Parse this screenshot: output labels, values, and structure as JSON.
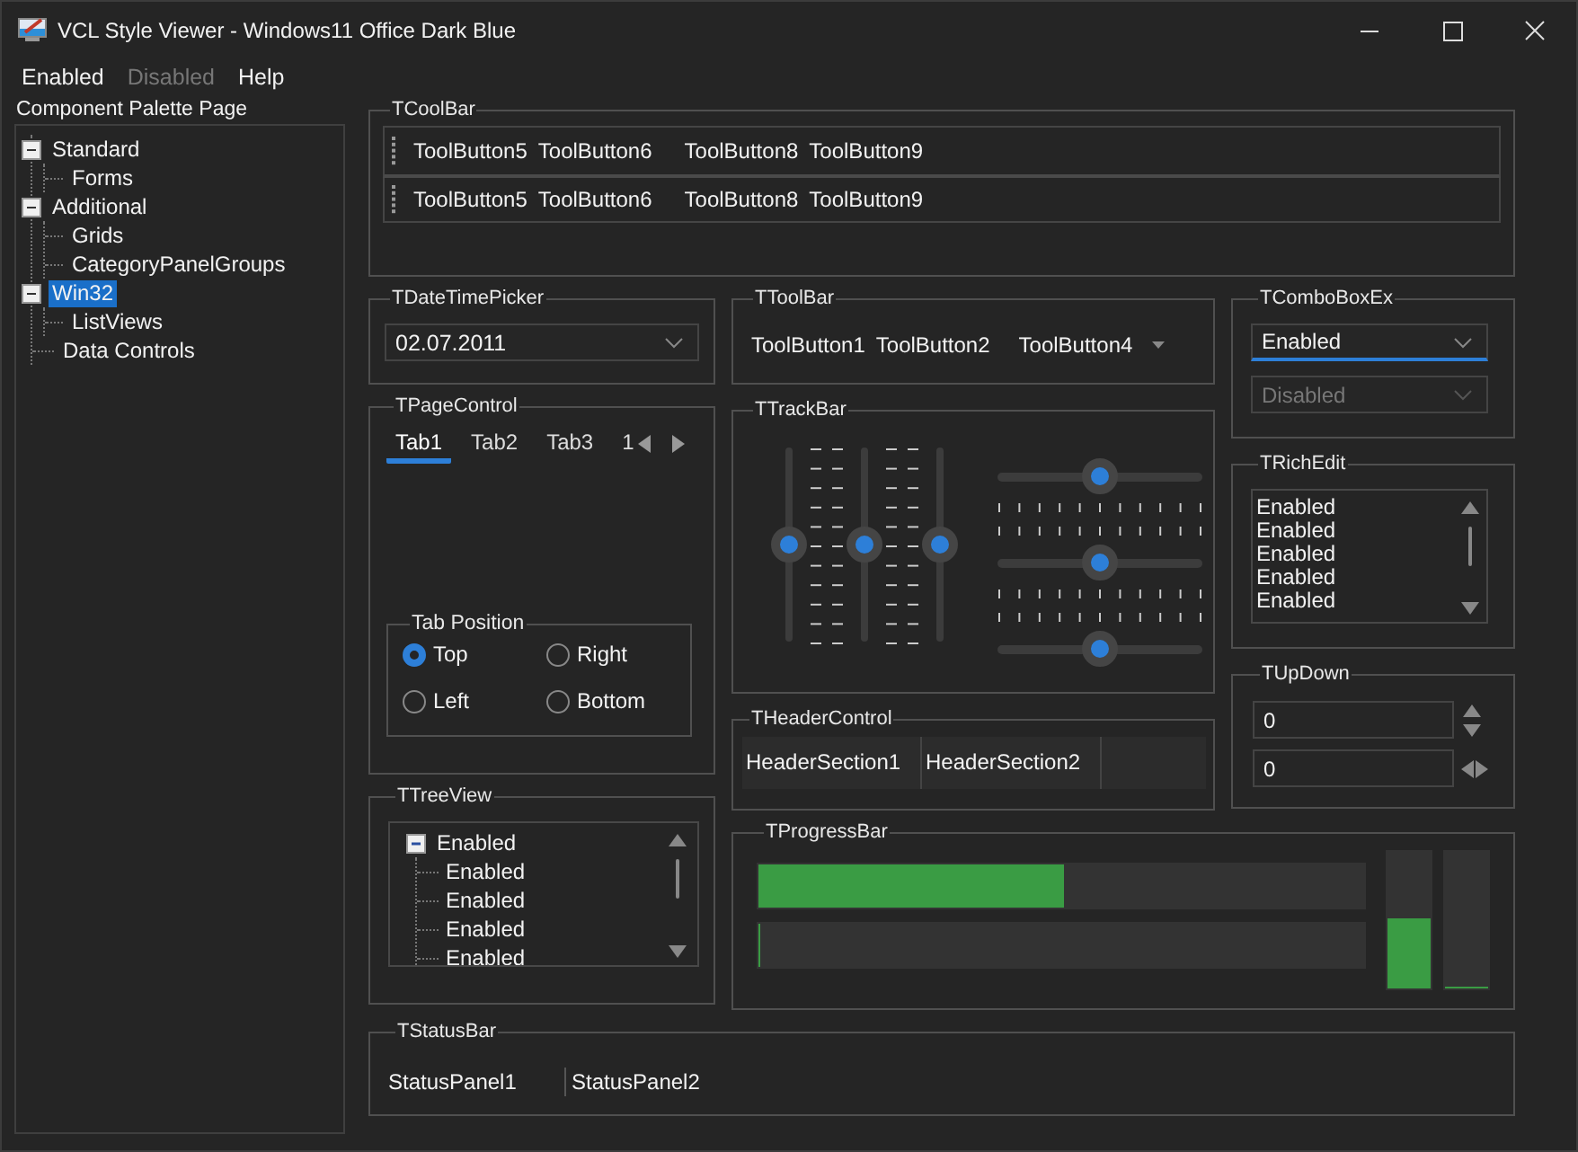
{
  "window": {
    "title": "VCL Style Viewer - Windows11 Office Dark Blue"
  },
  "menu": [
    {
      "label": "Enabled",
      "disabled": false
    },
    {
      "label": "Disabled",
      "disabled": true
    },
    {
      "label": "Help",
      "disabled": false
    }
  ],
  "palette": {
    "label": "Component Palette Page",
    "items": [
      {
        "label": "Standard",
        "expanded": true,
        "selected": false,
        "children": [
          {
            "label": "Forms",
            "selected": false
          }
        ]
      },
      {
        "label": "Additional",
        "expanded": true,
        "selected": false,
        "children": [
          {
            "label": "Grids",
            "selected": false
          },
          {
            "label": "CategoryPanelGroups",
            "selected": false
          }
        ]
      },
      {
        "label": "Win32",
        "expanded": true,
        "selected": true,
        "children": [
          {
            "label": "ListViews",
            "selected": false
          }
        ]
      },
      {
        "label": "Data Controls",
        "selected": false
      }
    ]
  },
  "coolbar": {
    "title": "TCoolBar",
    "bands": [
      {
        "items": [
          {
            "kind": "button",
            "label": "ToolButton5"
          },
          {
            "kind": "button",
            "label": "ToolButton6"
          },
          {
            "kind": "separator"
          },
          {
            "kind": "button",
            "label": "ToolButton8"
          },
          {
            "kind": "button",
            "label": "ToolButton9"
          }
        ]
      },
      {
        "items": [
          {
            "kind": "button",
            "label": "ToolButton5"
          },
          {
            "kind": "button",
            "label": "ToolButton6"
          },
          {
            "kind": "separator"
          },
          {
            "kind": "button",
            "label": "ToolButton8"
          },
          {
            "kind": "button",
            "label": "ToolButton9"
          }
        ]
      }
    ]
  },
  "datetimepicker": {
    "title": "TDateTimePicker",
    "value": "02.07.2011"
  },
  "toolbar": {
    "title": "TToolBar",
    "items": [
      {
        "kind": "button",
        "label": "ToolButton1"
      },
      {
        "kind": "button",
        "label": "ToolButton2"
      },
      {
        "kind": "separator"
      },
      {
        "kind": "dropdown",
        "label": "ToolButton4"
      }
    ]
  },
  "comboboxex": {
    "title": "TComboBoxEx",
    "combos": [
      {
        "value": "Enabled",
        "disabled": false,
        "focused": true
      },
      {
        "value": "Disabled",
        "disabled": true,
        "focused": false
      }
    ]
  },
  "pagecontrol": {
    "title": "TPageControl",
    "tabs": [
      {
        "label": "Tab1",
        "selected": true
      },
      {
        "label": "Tab2",
        "selected": false
      },
      {
        "label": "Tab3",
        "selected": false
      },
      {
        "label": "1",
        "selected": false
      }
    ],
    "tab_position": {
      "title": "Tab Position",
      "options": [
        {
          "label": "Top",
          "selected": true
        },
        {
          "label": "Right",
          "selected": false
        },
        {
          "label": "Left",
          "selected": false
        },
        {
          "label": "Bottom",
          "selected": false
        }
      ]
    }
  },
  "trackbar": {
    "title": "TTrackBar",
    "vertical": [
      {
        "level": 0.5,
        "kind": "right"
      },
      {
        "level": 0.5,
        "kind": "both"
      },
      {
        "level": 0.5,
        "kind": "left"
      }
    ],
    "horizontal": [
      {
        "level": 0.5,
        "kind": "below"
      },
      {
        "level": 0.5,
        "kind": "both"
      },
      {
        "level": 0.5,
        "kind": "above"
      }
    ]
  },
  "richedit": {
    "title": "TRichEdit",
    "lines": [
      "Enabled",
      "Enabled",
      "Enabled",
      "Enabled",
      "Enabled"
    ]
  },
  "updown": {
    "title": "TUpDown",
    "edits": [
      {
        "value": "0",
        "kind": "vertical"
      },
      {
        "value": "0",
        "kind": "horizontal"
      }
    ]
  },
  "headercontrol": {
    "title": "THeaderControl",
    "sections": [
      "HeaderSection1",
      "HeaderSection2"
    ]
  },
  "treeview": {
    "title": "TTreeView",
    "root": {
      "label": "Enabled",
      "expanded": true,
      "children": [
        {
          "label": "Enabled"
        },
        {
          "label": "Enabled"
        },
        {
          "label": "Enabled"
        },
        {
          "label": "Enabled"
        }
      ]
    }
  },
  "progressbar": {
    "title": "TProgressBar",
    "bars": [
      {
        "kind": "horizontal",
        "level": 0.5
      },
      {
        "kind": "horizontal",
        "level": 0
      },
      {
        "kind": "vertical",
        "level": 0.5
      },
      {
        "kind": "vertical",
        "level": 0
      }
    ]
  },
  "statusbar": {
    "title": "TStatusBar",
    "panels": [
      "StatusPanel1",
      "StatusPanel2"
    ]
  }
}
